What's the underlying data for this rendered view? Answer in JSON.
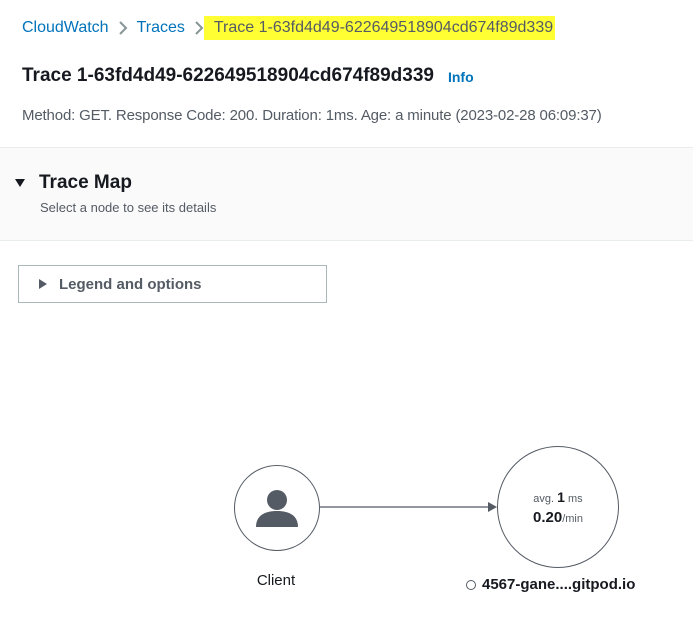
{
  "breadcrumb": {
    "items": [
      "CloudWatch",
      "Traces"
    ],
    "current": "Trace 1-63fd4d49-622649518904cd674f89d339"
  },
  "header": {
    "title": "Trace 1-63fd4d49-622649518904cd674f89d339",
    "info_label": "Info",
    "summary": "Method: GET. Response Code: 200. Duration: 1ms. Age: a minute (2023-02-28 06:09:37)"
  },
  "trace_map": {
    "title": "Trace Map",
    "description": "Select a node to see its details",
    "legend_label": "Legend and options",
    "client": {
      "label": "Client",
      "icon": "user-icon"
    },
    "service": {
      "name": "4567-gane....gitpod.io",
      "avg_prefix": "avg.",
      "avg_value": "1",
      "avg_unit": "ms",
      "rate_value": "0.20",
      "rate_unit": "/min"
    }
  },
  "colors": {
    "link": "#0073bb",
    "highlight": "#ffff33",
    "node_border": "#545b64",
    "user_icon": "#545b64"
  }
}
